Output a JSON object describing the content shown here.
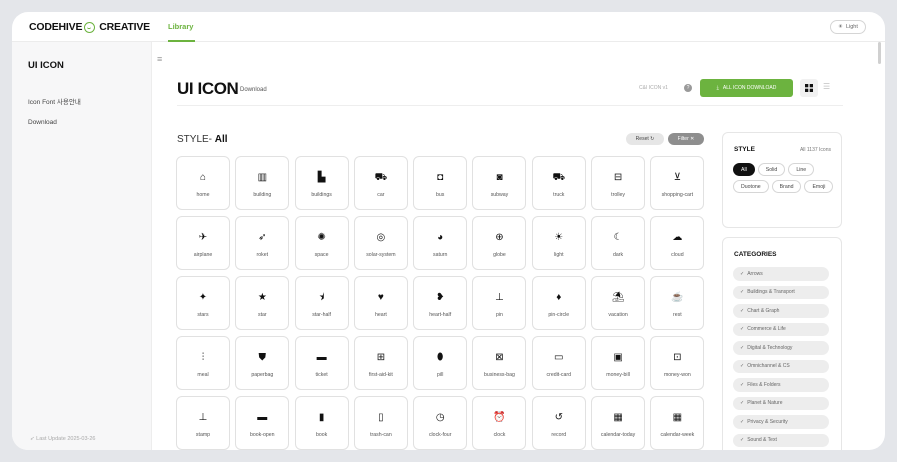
{
  "header": {
    "brand_part1": "CODEHIVE",
    "brand_part2": "CREATIVE",
    "nav_library": "Library",
    "theme_toggle": "Light"
  },
  "sidebar": {
    "title": "UI ICON",
    "items": [
      "Icon Font 사용안내",
      "Download"
    ],
    "footer": "Last Update 2025-03-26"
  },
  "main": {
    "title": "UI ICON",
    "subtitle": "Download",
    "version": "C&I ICON v1",
    "download_button": "ALL ICON DOWNLOAD",
    "style_prefix": "STYLE-",
    "style_value": "All",
    "reset_label": "Reset",
    "filter_label": "Filter"
  },
  "icons": [
    {
      "name": "home",
      "glyph": "⌂",
      "icon": "home-icon"
    },
    {
      "name": "building",
      "glyph": "▥",
      "icon": "building-icon"
    },
    {
      "name": "buildings",
      "glyph": "▙",
      "icon": "buildings-icon"
    },
    {
      "name": "car",
      "glyph": "⛟",
      "icon": "car-icon"
    },
    {
      "name": "bus",
      "glyph": "◘",
      "icon": "bus-icon"
    },
    {
      "name": "subway",
      "glyph": "◙",
      "icon": "subway-icon"
    },
    {
      "name": "truck",
      "glyph": "⛟",
      "icon": "truck-icon"
    },
    {
      "name": "trolley",
      "glyph": "⊟",
      "icon": "trolley-icon"
    },
    {
      "name": "shopping-cart",
      "glyph": "⊻",
      "icon": "shopping-cart-icon"
    },
    {
      "name": "airplane",
      "glyph": "✈",
      "icon": "airplane-icon"
    },
    {
      "name": "roket",
      "glyph": "➶",
      "icon": "rocket-icon"
    },
    {
      "name": "space",
      "glyph": "✺",
      "icon": "space-icon"
    },
    {
      "name": "solar-system",
      "glyph": "◎",
      "icon": "solar-system-icon"
    },
    {
      "name": "saturn",
      "glyph": "◕",
      "icon": "saturn-icon"
    },
    {
      "name": "globe",
      "glyph": "⊕",
      "icon": "globe-icon"
    },
    {
      "name": "light",
      "glyph": "☀",
      "icon": "light-icon"
    },
    {
      "name": "dark",
      "glyph": "☾",
      "icon": "dark-icon"
    },
    {
      "name": "cloud",
      "glyph": "☁",
      "icon": "cloud-icon"
    },
    {
      "name": "stars",
      "glyph": "✦",
      "icon": "stars-icon"
    },
    {
      "name": "star",
      "glyph": "★",
      "icon": "star-icon"
    },
    {
      "name": "star-half",
      "glyph": "⯨",
      "icon": "star-half-icon"
    },
    {
      "name": "heart",
      "glyph": "♥",
      "icon": "heart-icon"
    },
    {
      "name": "heart-half",
      "glyph": "❥",
      "icon": "heart-half-icon"
    },
    {
      "name": "pin",
      "glyph": "⊥",
      "icon": "pin-icon"
    },
    {
      "name": "pin-circle",
      "glyph": "♦",
      "icon": "pin-circle-icon"
    },
    {
      "name": "vacation",
      "glyph": "⛱",
      "icon": "vacation-icon"
    },
    {
      "name": "rest",
      "glyph": "☕",
      "icon": "rest-icon"
    },
    {
      "name": "meal",
      "glyph": "⫶",
      "icon": "meal-icon"
    },
    {
      "name": "paperbag",
      "glyph": "⛊",
      "icon": "paperbag-icon"
    },
    {
      "name": "ticket",
      "glyph": "▬",
      "icon": "ticket-icon"
    },
    {
      "name": "first-aid-kit",
      "glyph": "⊞",
      "icon": "first-aid-kit-icon"
    },
    {
      "name": "pill",
      "glyph": "⬮",
      "icon": "pill-icon"
    },
    {
      "name": "business-bag",
      "glyph": "⊠",
      "icon": "business-bag-icon"
    },
    {
      "name": "credit-card",
      "glyph": "▭",
      "icon": "credit-card-icon"
    },
    {
      "name": "money-bill",
      "glyph": "▣",
      "icon": "money-bill-icon"
    },
    {
      "name": "money-won",
      "glyph": "⊡",
      "icon": "money-won-icon"
    },
    {
      "name": "stamp",
      "glyph": "⊥",
      "icon": "stamp-icon"
    },
    {
      "name": "book-open",
      "glyph": "▬",
      "icon": "book-open-icon"
    },
    {
      "name": "book",
      "glyph": "▮",
      "icon": "book-icon"
    },
    {
      "name": "trash-can",
      "glyph": "▯",
      "icon": "trash-can-icon"
    },
    {
      "name": "clock-four",
      "glyph": "◷",
      "icon": "clock-four-icon"
    },
    {
      "name": "clock",
      "glyph": "⏰",
      "icon": "clock-icon"
    },
    {
      "name": "record",
      "glyph": "↺",
      "icon": "record-icon"
    },
    {
      "name": "calendar-today",
      "glyph": "▦",
      "icon": "calendar-today-icon"
    },
    {
      "name": "calendar-week",
      "glyph": "▦",
      "icon": "calendar-week-icon"
    }
  ],
  "style_panel": {
    "title": "STYLE",
    "count": "All 1137 Icons",
    "chips": [
      "All",
      "Solid",
      "Line",
      "Duotone",
      "Brand",
      "Emoji"
    ],
    "active_chip": "All"
  },
  "categories_panel": {
    "title": "CATEGORIES",
    "items": [
      "Arrows",
      "Buildings & Transport",
      "Chart & Graph",
      "Commerce & Life",
      "Digital & Technology",
      "Omnichannel & CS",
      "Files & Folders",
      "Planet & Nature",
      "Privacy & Security",
      "Sound & Text"
    ]
  },
  "colors": {
    "accent": "#6cb33f",
    "frame_bg": "#e4e6ea",
    "chip_active": "#111111"
  }
}
